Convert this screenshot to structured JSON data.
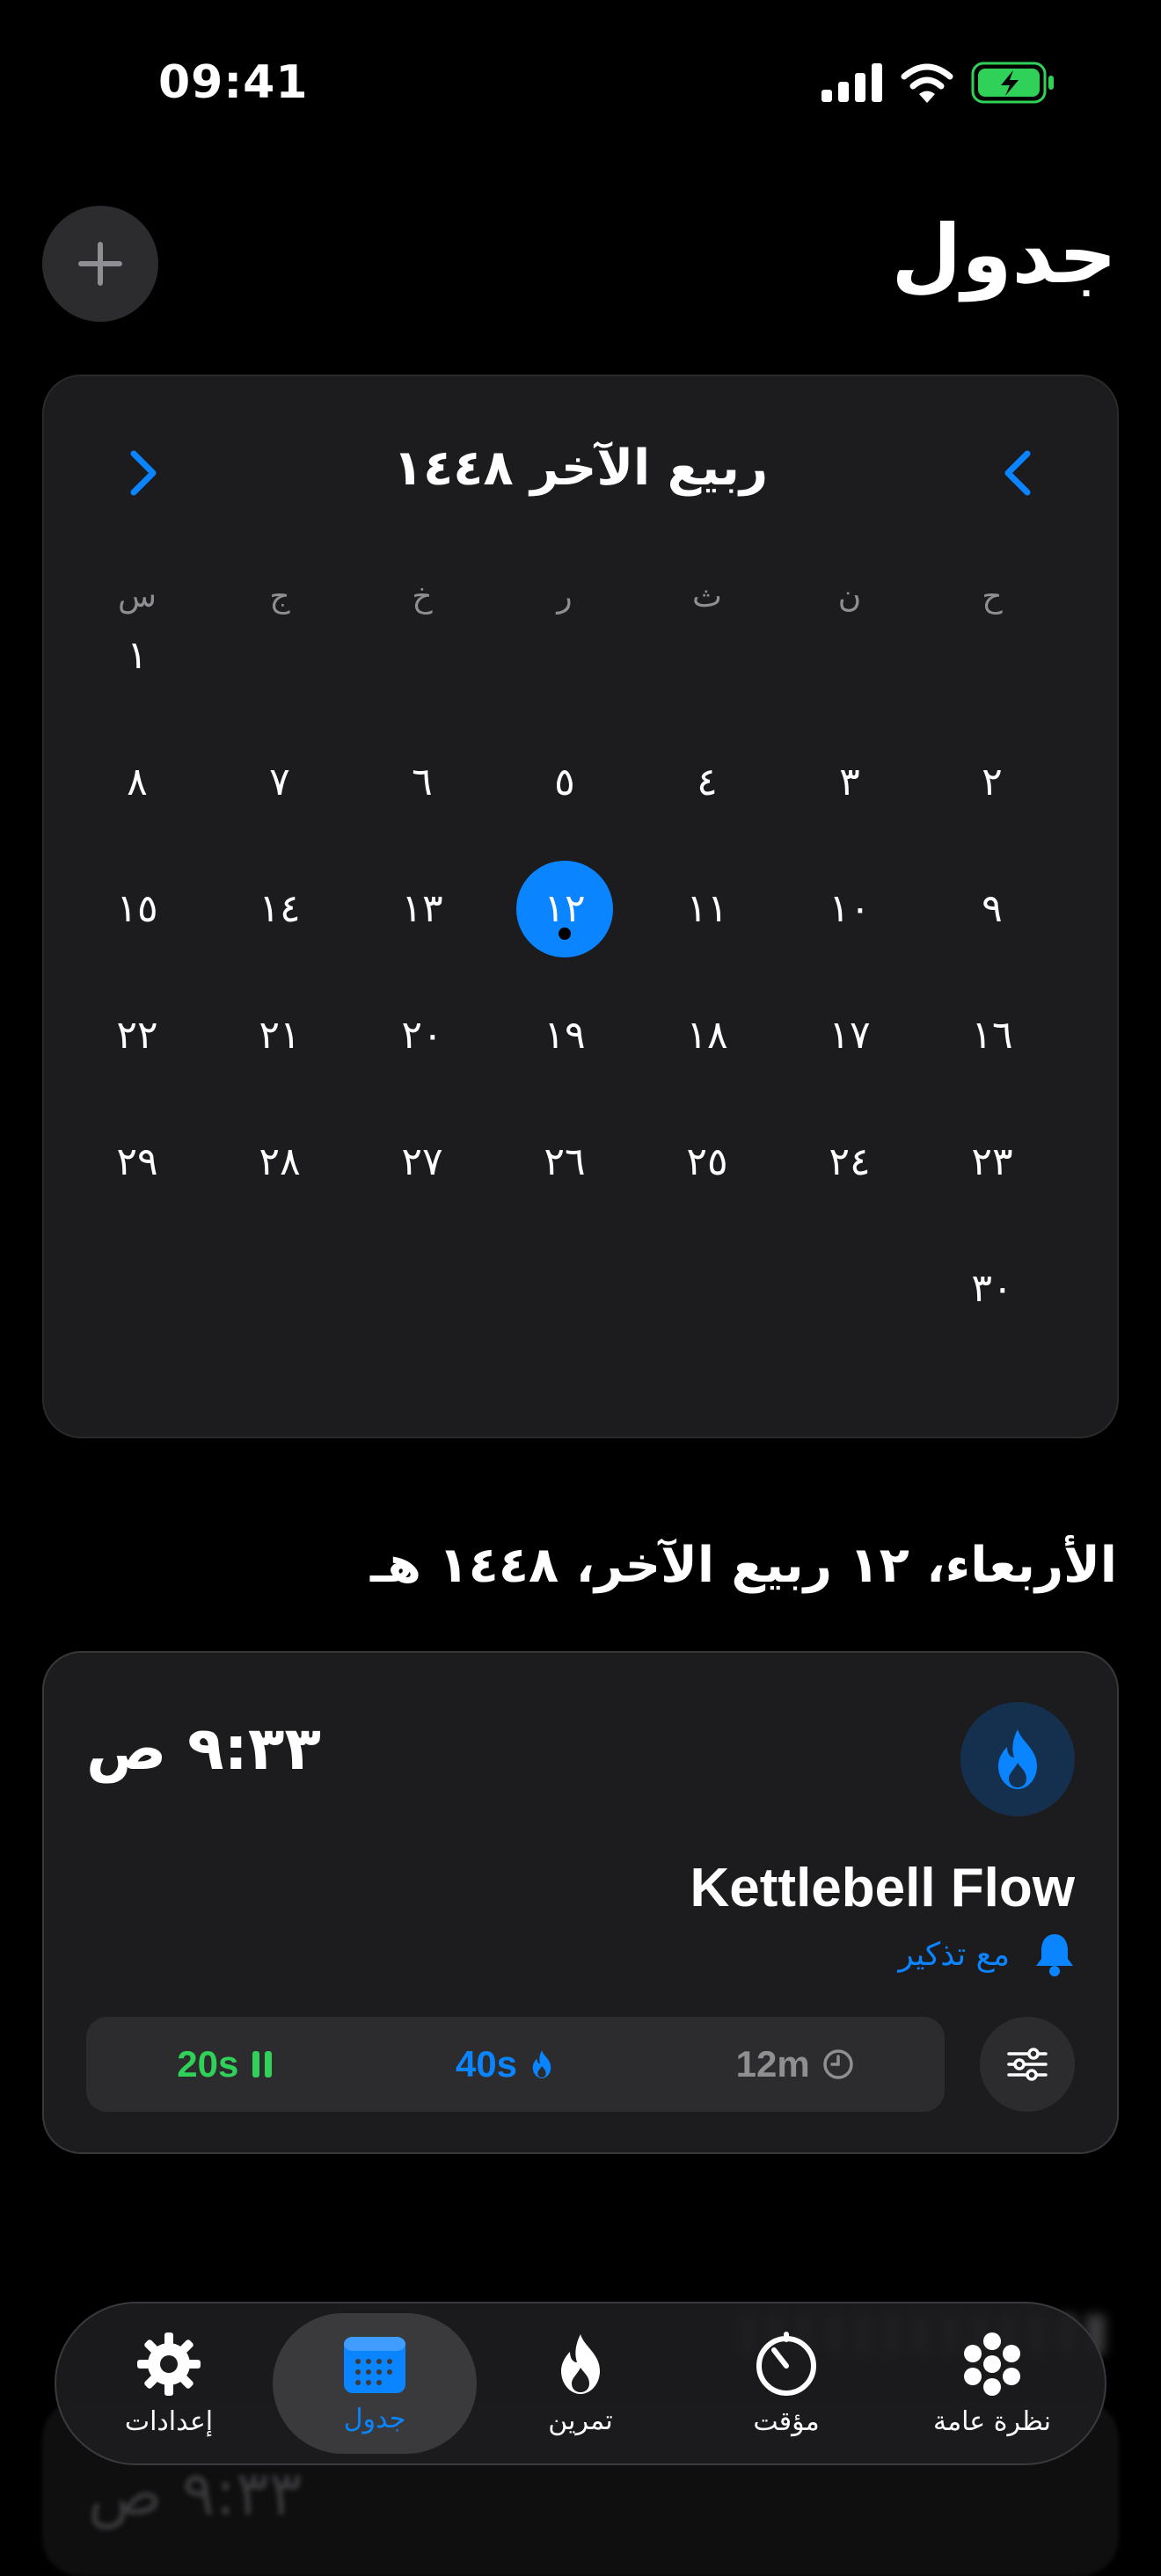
{
  "status_bar": {
    "time": "09:41"
  },
  "header": {
    "title": "جدول",
    "add_icon": "plus-icon"
  },
  "calendar": {
    "month_title": "ربيع الآخر ١٤٤٨",
    "weekdays": [
      "ح",
      "ن",
      "ث",
      "ر",
      "خ",
      "ج",
      "س"
    ],
    "days": [
      "١",
      "٢",
      "٣",
      "٤",
      "٥",
      "٦",
      "٧",
      "٨",
      "٩",
      "١٠",
      "١١",
      "١٢",
      "١٣",
      "١٤",
      "١٥",
      "١٦",
      "١٧",
      "١٨",
      "١٩",
      "٢٠",
      "٢١",
      "٢٢",
      "٢٣",
      "٢٤",
      "٢٥",
      "٢٦",
      "٢٧",
      "٢٨",
      "٢٩",
      "٣٠"
    ],
    "today": "١٢",
    "colors": {
      "accent": "#0a84ff",
      "card": "#1c1c1e"
    }
  },
  "selected_date": "الأربعاء، ١٢ ربيع الآخر، ١٤٤٨ هـ",
  "workout": {
    "time": "٩:٣٣ ص",
    "name": "Kettlebell Flow",
    "reminder": "مع تذكير",
    "rest": "20s",
    "work": "40s",
    "duration": "12m",
    "colors": {
      "rest": "#30d158",
      "work": "#0a84ff",
      "duration": "#8e8e93"
    }
  },
  "peek": {
    "time": "٩:٣٣ ص"
  },
  "tabbar": {
    "tabs": [
      {
        "label": "إعدادات",
        "icon": "gear-icon"
      },
      {
        "label": "جدول",
        "icon": "calendar-icon"
      },
      {
        "label": "تمرين",
        "icon": "flame-icon"
      },
      {
        "label": "مؤقت",
        "icon": "timer-icon"
      },
      {
        "label": "نظرة عامة",
        "icon": "overview-icon"
      }
    ],
    "active": "جدول"
  }
}
